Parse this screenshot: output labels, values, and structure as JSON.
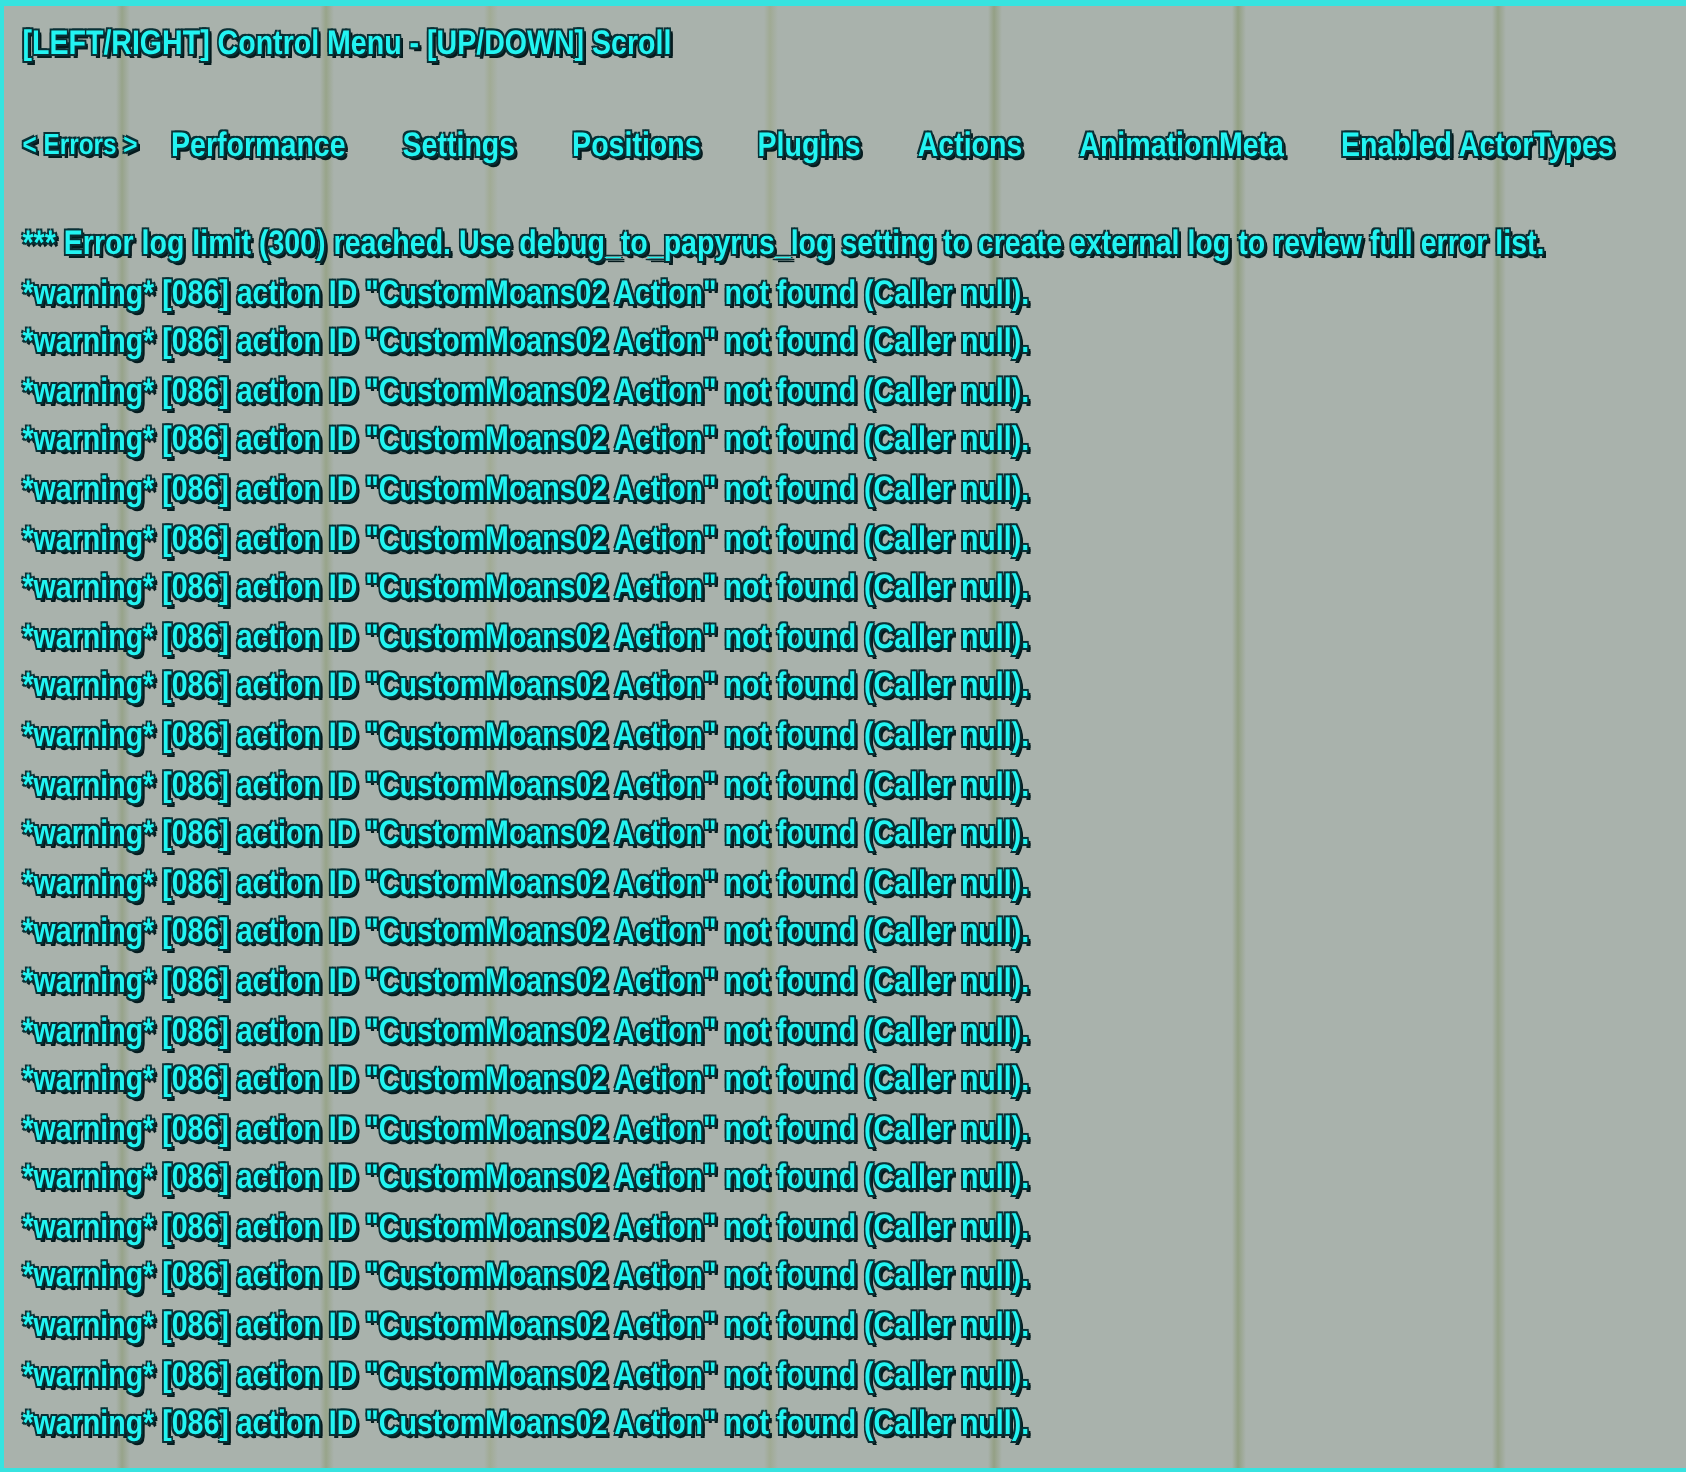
{
  "header": {
    "hint": "[LEFT/RIGHT] Control Menu - [UP/DOWN] Scroll"
  },
  "selection_marks": {
    "before": "<",
    "after": ">"
  },
  "tabs": [
    {
      "label": "Errors",
      "selected": true
    },
    {
      "label": "Performance",
      "selected": false
    },
    {
      "label": "Settings",
      "selected": false
    },
    {
      "label": "Positions",
      "selected": false
    },
    {
      "label": "Plugins",
      "selected": false
    },
    {
      "label": "Actions",
      "selected": false
    },
    {
      "label": "AnimationMeta",
      "selected": false
    },
    {
      "label": "Enabled ActorTypes",
      "selected": false
    }
  ],
  "log_lines": [
    "*** Error log limit (300) reached. Use debug_to_papyrus_log setting to create external log to review full error list.",
    "*warning* [086] action ID \"CustomMoans02 Action\" not found (Caller null).",
    "*warning* [086] action ID \"CustomMoans02 Action\" not found (Caller null).",
    "*warning* [086] action ID \"CustomMoans02 Action\" not found (Caller null).",
    "*warning* [086] action ID \"CustomMoans02 Action\" not found (Caller null).",
    "*warning* [086] action ID \"CustomMoans02 Action\" not found (Caller null).",
    "*warning* [086] action ID \"CustomMoans02 Action\" not found (Caller null).",
    "*warning* [086] action ID \"CustomMoans02 Action\" not found (Caller null).",
    "*warning* [086] action ID \"CustomMoans02 Action\" not found (Caller null).",
    "*warning* [086] action ID \"CustomMoans02 Action\" not found (Caller null).",
    "*warning* [086] action ID \"CustomMoans02 Action\" not found (Caller null).",
    "*warning* [086] action ID \"CustomMoans02 Action\" not found (Caller null).",
    "*warning* [086] action ID \"CustomMoans02 Action\" not found (Caller null).",
    "*warning* [086] action ID \"CustomMoans02 Action\" not found (Caller null).",
    "*warning* [086] action ID \"CustomMoans02 Action\" not found (Caller null).",
    "*warning* [086] action ID \"CustomMoans02 Action\" not found (Caller null).",
    "*warning* [086] action ID \"CustomMoans02 Action\" not found (Caller null).",
    "*warning* [086] action ID \"CustomMoans02 Action\" not found (Caller null).",
    "*warning* [086] action ID \"CustomMoans02 Action\" not found (Caller null).",
    "*warning* [086] action ID \"CustomMoans02 Action\" not found (Caller null).",
    "*warning* [086] action ID \"CustomMoans02 Action\" not found (Caller null).",
    "*warning* [086] action ID \"CustomMoans02 Action\" not found (Caller null).",
    "*warning* [086] action ID \"CustomMoans02 Action\" not found (Caller null).",
    "*warning* [086] action ID \"CustomMoans02 Action\" not found (Caller null).",
    "*warning* [086] action ID \"CustomMoans02 Action\" not found (Caller null)."
  ]
}
